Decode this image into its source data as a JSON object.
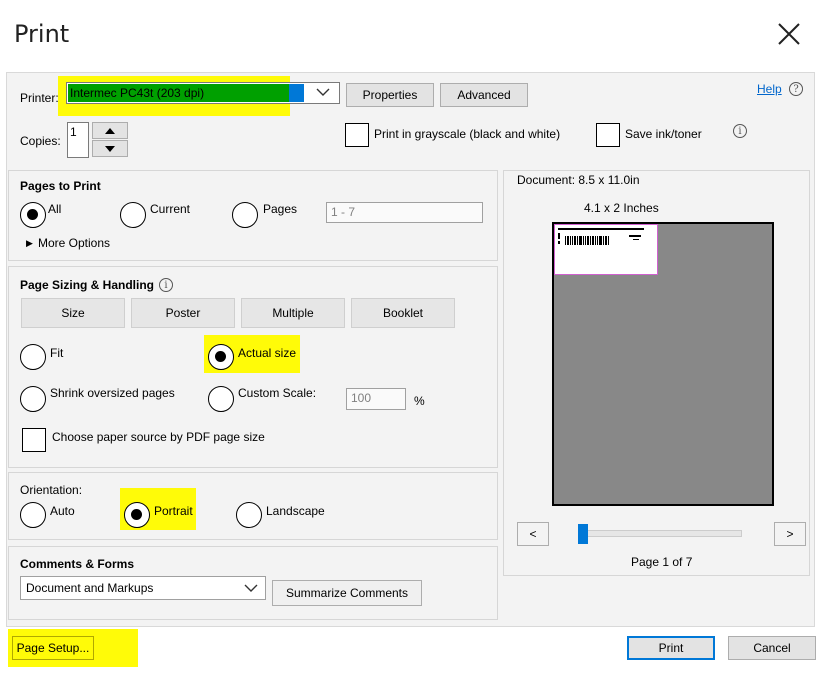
{
  "dialog": {
    "title": "Print",
    "help_label": "Help"
  },
  "printer": {
    "label": "Printer:",
    "selected": "Intermec PC43t (203 dpi)",
    "properties_label": "Properties",
    "advanced_label": "Advanced"
  },
  "copies": {
    "label": "Copies:",
    "value": "1"
  },
  "options": {
    "grayscale_label": "Print in grayscale (black and white)",
    "save_ink_label": "Save ink/toner"
  },
  "pages_to_print": {
    "heading": "Pages to Print",
    "all_label": "All",
    "current_label": "Current",
    "pages_label": "Pages",
    "pages_value": "1 - 7",
    "more_options_label": "More Options"
  },
  "sizing": {
    "heading": "Page Sizing & Handling",
    "tabs": [
      "Size",
      "Poster",
      "Multiple",
      "Booklet"
    ],
    "fit_label": "Fit",
    "actual_size_label": "Actual size",
    "shrink_label": "Shrink oversized pages",
    "custom_scale_label": "Custom Scale:",
    "custom_scale_value": "100",
    "percent": "%",
    "paper_source_label": "Choose paper source by PDF page size"
  },
  "orientation": {
    "heading": "Orientation:",
    "auto_label": "Auto",
    "portrait_label": "Portrait",
    "landscape_label": "Landscape"
  },
  "comments_forms": {
    "heading": "Comments & Forms",
    "selected": "Document and Markups",
    "summarize_label": "Summarize Comments"
  },
  "preview": {
    "document_size": "Document: 8.5 x 11.0in",
    "label_size": "4.1 x 2 Inches",
    "prev_label": "<",
    "next_label": ">",
    "page_indicator": "Page 1 of 7",
    "slider_value": 0
  },
  "footer": {
    "page_setup_label": "Page Setup...",
    "print_label": "Print",
    "cancel_label": "Cancel"
  },
  "colors": {
    "highlight": "#fffb08",
    "printer_field": "#00a000",
    "focus_blue": "#0078d7",
    "preview_page": "#888888"
  }
}
